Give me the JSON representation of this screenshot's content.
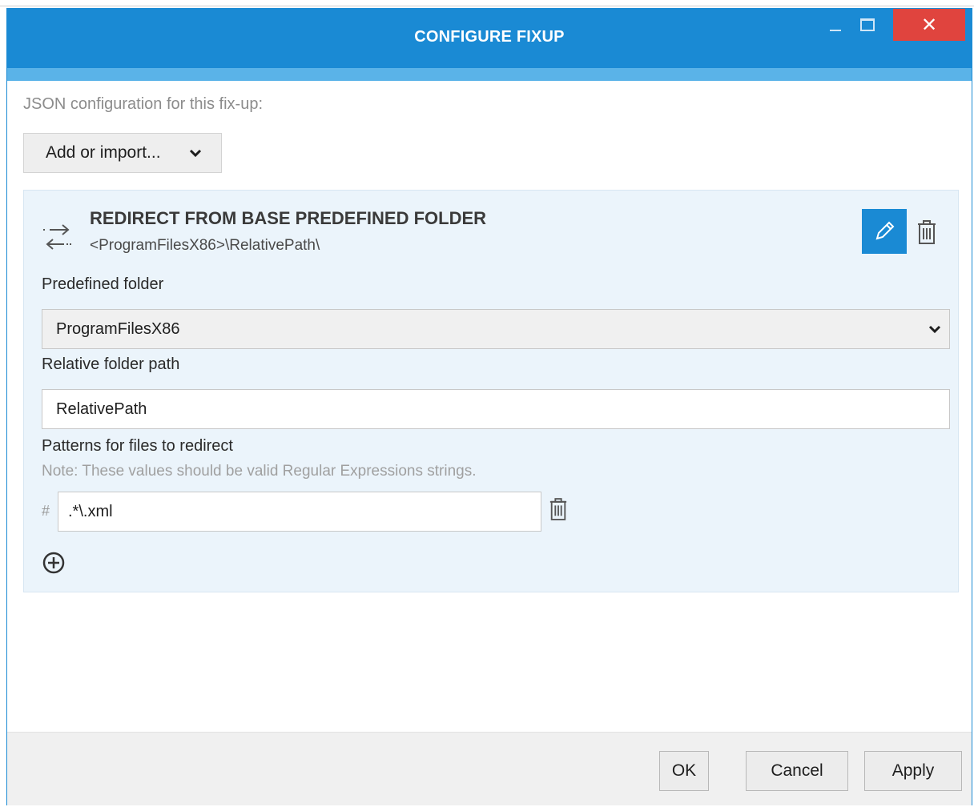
{
  "window": {
    "title": "CONFIGURE FIXUP",
    "close_glyph": "✕",
    "accent_color": "#1a8ad4",
    "close_color": "#e0443e"
  },
  "content": {
    "config_label": "JSON configuration for this fix-up:",
    "add_dropdown": {
      "label": "Add or import...",
      "icon": "chevron-down-icon"
    }
  },
  "fixup": {
    "icon": "redirect-arrows-icon",
    "title": "REDIRECT FROM BASE PREDEFINED FOLDER",
    "subtitle": "<ProgramFilesX86>\\RelativePath\\",
    "edit_icon": "pencil-icon",
    "delete_icon": "trash-icon",
    "predefined_folder": {
      "label": "Predefined folder",
      "value": "ProgramFilesX86"
    },
    "relative_path": {
      "label": "Relative folder path",
      "value": "RelativePath"
    },
    "patterns": {
      "label": "Patterns for files to redirect",
      "note": "Note: These values should be valid Regular Expressions strings.",
      "hash": "#",
      "items": [
        {
          "value": ".*\\.xml"
        }
      ],
      "add_icon": "plus-circle-icon"
    }
  },
  "footer": {
    "ok_label": "OK",
    "cancel_label": "Cancel",
    "apply_label": "Apply"
  }
}
